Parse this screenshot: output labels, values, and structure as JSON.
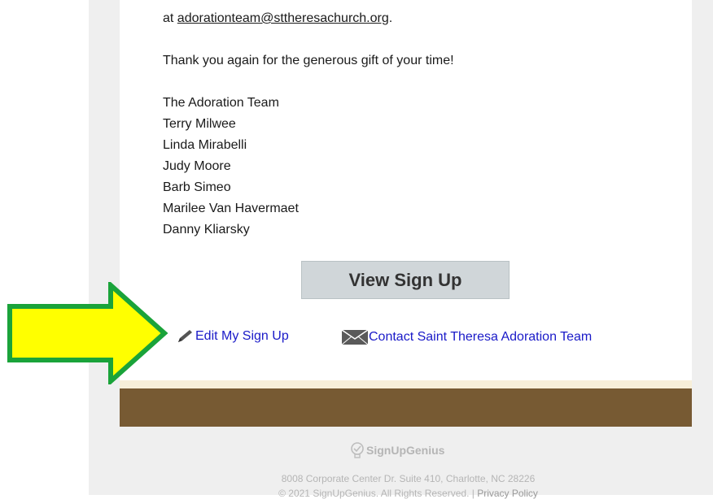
{
  "email": {
    "contact_prefix": "at ",
    "contact_email": "adorationteam@sttheresachurch.org",
    "contact_suffix": ".",
    "thanks": "Thank you again for the generous gift of your time!",
    "signature": [
      "The Adoration Team",
      "Terry Milwee",
      "Linda Mirabelli",
      "Judy Moore",
      "Barb Simeo",
      "Marilee Van Havermaet",
      "Danny Kliarsky"
    ]
  },
  "actions": {
    "view_signup_label": "View Sign Up",
    "edit_label": "Edit My Sign Up",
    "contact_label": "Contact Saint Theresa Adoration Team"
  },
  "footer": {
    "logo_text": "SignUpGenius",
    "address": "8008 Corporate Center Dr. Suite 410, Charlotte, NC 28226",
    "copyright": "© 2021 SignUpGenius. All Rights Reserved. | ",
    "privacy_label": "Privacy Policy"
  },
  "colors": {
    "arrow_fill": "#ffff00",
    "arrow_stroke": "#1aa33a",
    "brown_bar": "#775a33",
    "link": "#1a1ac8"
  },
  "icons": [
    "pencil-icon",
    "envelope-icon",
    "lightbulb-icon",
    "arrow-annotation"
  ]
}
